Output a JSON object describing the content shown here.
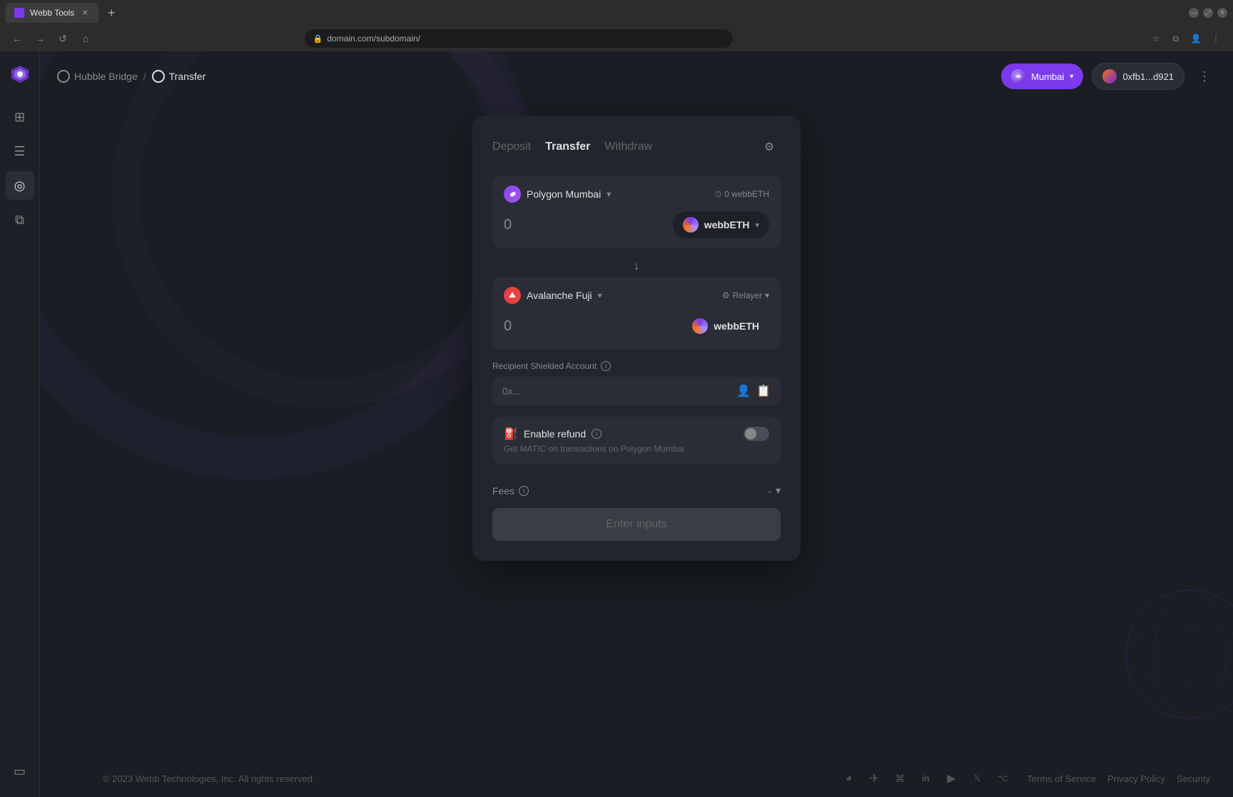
{
  "browser": {
    "tab_label": "Webb Tools",
    "tab_new_label": "+",
    "url": "domain.com/subdomain/",
    "nav_back": "←",
    "nav_forward": "→",
    "nav_refresh": "↺",
    "nav_home": "⌂"
  },
  "sidebar": {
    "logo_alt": "Webb Logo",
    "items": [
      {
        "name": "grid",
        "label": "Grid",
        "icon": "⊞",
        "active": false
      },
      {
        "name": "document",
        "label": "Document",
        "icon": "☰",
        "active": false
      },
      {
        "name": "circle-target",
        "label": "Target",
        "icon": "◎",
        "active": true
      },
      {
        "name": "nodes",
        "label": "Nodes",
        "icon": "⧉",
        "active": false
      }
    ],
    "bottom_item": {
      "name": "terminal",
      "label": "Terminal",
      "icon": "▭"
    }
  },
  "nav": {
    "breadcrumb_parent": "Hubble Bridge",
    "breadcrumb_separator": "/",
    "breadcrumb_current": "Transfer",
    "network_label": "Mumbai",
    "wallet_label": "0xfb1...d921",
    "more_icon": "⋮"
  },
  "card": {
    "tab_deposit": "Deposit",
    "tab_transfer": "Transfer",
    "tab_withdraw": "Withdraw",
    "active_tab": "Transfer",
    "settings_icon": "⚙",
    "source": {
      "chain_name": "Polygon Mumbai",
      "chain_chevron": "▾",
      "balance_prefix": "◷",
      "balance": "0 webbETH",
      "amount": "0",
      "token_name": "webbETH",
      "token_chevron": "▾"
    },
    "arrow": "↓",
    "dest": {
      "chain_name": "Avalanche Fuji",
      "chain_chevron": "▾",
      "relayer_label": "Relayer",
      "relayer_chevron": "▾",
      "amount": "0",
      "token_name": "webbETH"
    },
    "recipient": {
      "label": "Recipient Shielded Account",
      "info": "i",
      "placeholder": "0x..."
    },
    "refund": {
      "icon": "⛽",
      "title": "Enable refund",
      "info": "i",
      "description": "Get MATIC on transactions on Polygon Mumbai",
      "toggle_state": false
    },
    "fees": {
      "label": "Fees",
      "info": "i",
      "value": "-",
      "chevron": "▾"
    },
    "submit_label": "Enter inputs"
  },
  "footer": {
    "copyright": "© 2023 Webb Technologies, Inc. All rights reserved.",
    "links": [
      {
        "label": "Terms of Service"
      },
      {
        "label": "Privacy Policy"
      },
      {
        "label": "Security"
      }
    ],
    "social_icons": [
      {
        "name": "webb-icon",
        "icon": "◕"
      },
      {
        "name": "telegram-icon",
        "icon": "✈"
      },
      {
        "name": "discord-icon",
        "icon": "⌘"
      },
      {
        "name": "linkedin-icon",
        "icon": "in"
      },
      {
        "name": "youtube-icon",
        "icon": "▶"
      },
      {
        "name": "twitter-icon",
        "icon": "𝕏"
      },
      {
        "name": "github-icon",
        "icon": "⌥"
      }
    ]
  },
  "colors": {
    "accent": "#7c3aed",
    "bg_primary": "#1a1d23",
    "bg_card": "#22252e",
    "bg_input": "#2a2d36"
  }
}
